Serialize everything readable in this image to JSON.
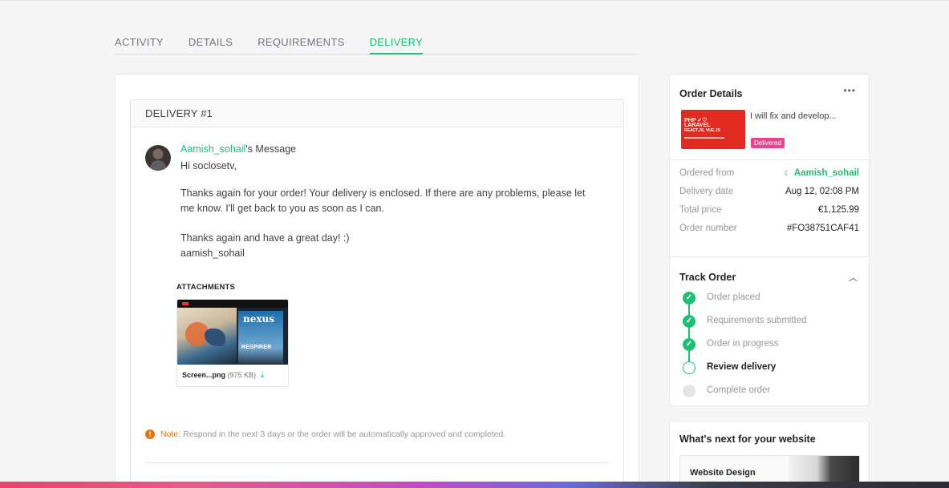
{
  "tabs": [
    {
      "label": "ACTIVITY",
      "active": false
    },
    {
      "label": "DETAILS",
      "active": false
    },
    {
      "label": "REQUIREMENTS",
      "active": false
    },
    {
      "label": "DELIVERY",
      "active": true
    }
  ],
  "delivery": {
    "header": "DELIVERY #1",
    "sender": "Aamish_sohail",
    "message_suffix": "'s Message",
    "greeting": "Hi soclosetv,",
    "paragraph1": "Thanks again for your order! Your delivery is enclosed. If there are any problems, please let me know. I'll get back to you as soon as I can.",
    "paragraph2_line1": "Thanks again and have a great day! :)",
    "paragraph2_line2": "aamish_sohail",
    "attachments_title": "ATTACHMENTS",
    "attachment": {
      "file_name": "Screen...png",
      "file_size": "(975 KB)",
      "thumb_title": "nexus",
      "thumb_subtitle": "RESPIRER"
    },
    "note_label": "Note:",
    "note_text": "Respond in the next 3 days or the order will be automatically approved and completed."
  },
  "order_details": {
    "title": "Order Details",
    "more_icon": "ellipsis-icon",
    "gig_title": "I will fix and develop...",
    "gig_thumb": {
      "line1": "PHP ✓♡",
      "line2": "LARAVEL",
      "line3": "REACT.JS, VUE.JS"
    },
    "status_badge": "Delivered",
    "ordered_from_label": "Ordered from",
    "ordered_from_value": "Aamish_sohail",
    "delivery_date_label": "Delivery date",
    "delivery_date_value": "Aug 12, 02:08 PM",
    "total_price_label": "Total price",
    "total_price_value": "€1,125.99",
    "order_number_label": "Order number",
    "order_number_value": "#FO38751CAF41"
  },
  "track_order": {
    "title": "Track Order",
    "steps": [
      {
        "label": "Order placed",
        "state": "done"
      },
      {
        "label": "Requirements submitted",
        "state": "done"
      },
      {
        "label": "Order in progress",
        "state": "done"
      },
      {
        "label": "Review delivery",
        "state": "current"
      },
      {
        "label": "Complete order",
        "state": "todo"
      }
    ]
  },
  "whats_next": {
    "title": "What's next for your website",
    "item_label": "Website Design"
  },
  "colors": {
    "accent": "#1dbf73",
    "badge": "#e6458f",
    "note": "#e8700e"
  }
}
